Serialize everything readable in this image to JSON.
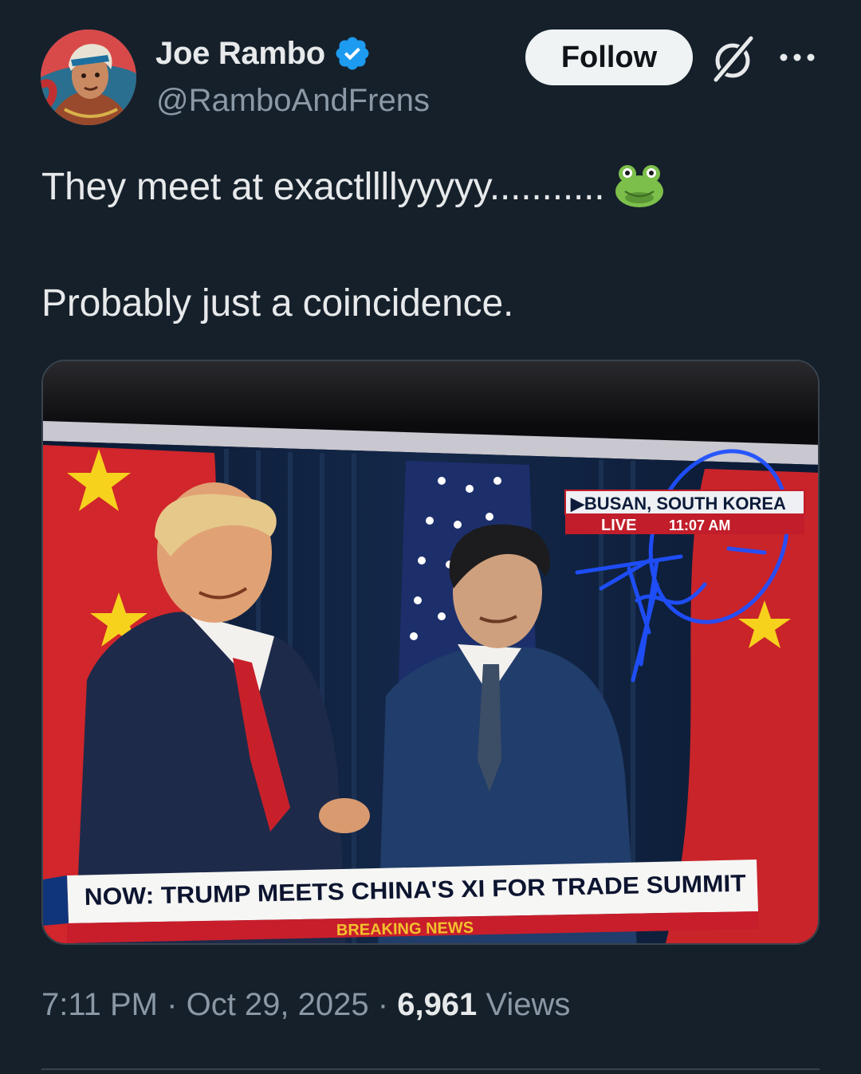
{
  "author": {
    "display_name": "Joe Rambo",
    "handle": "@RamboAndFrens",
    "verified": true,
    "avatar_icon": "cartoon-avatar"
  },
  "actions": {
    "follow_label": "Follow",
    "grok_icon": "grok-icon",
    "more_icon": "more-icon"
  },
  "tweet": {
    "line1": "They meet at exactllllyyyyy...........",
    "line1_emoji": "frog-face-icon",
    "line2": "Probably just a coincidence."
  },
  "media": {
    "location_label": "▶BUSAN, SOUTH KOREA",
    "live_label": "LIVE",
    "time_label": "11:07 AM",
    "headline": "NOW: TRUMP MEETS CHINA'S XI FOR TRADE SUMMIT",
    "breaking_label": "BREAKING NEWS"
  },
  "meta": {
    "time": "7:11 PM",
    "separator": "·",
    "date": "Oct 29, 2025",
    "views_count": "6,961",
    "views_label": "Views"
  },
  "colors": {
    "background": "#15202b",
    "text_primary": "#e7e9ea",
    "text_secondary": "#8b98a5",
    "verified_blue": "#1d9bf0",
    "follow_bg": "#eff3f4"
  }
}
